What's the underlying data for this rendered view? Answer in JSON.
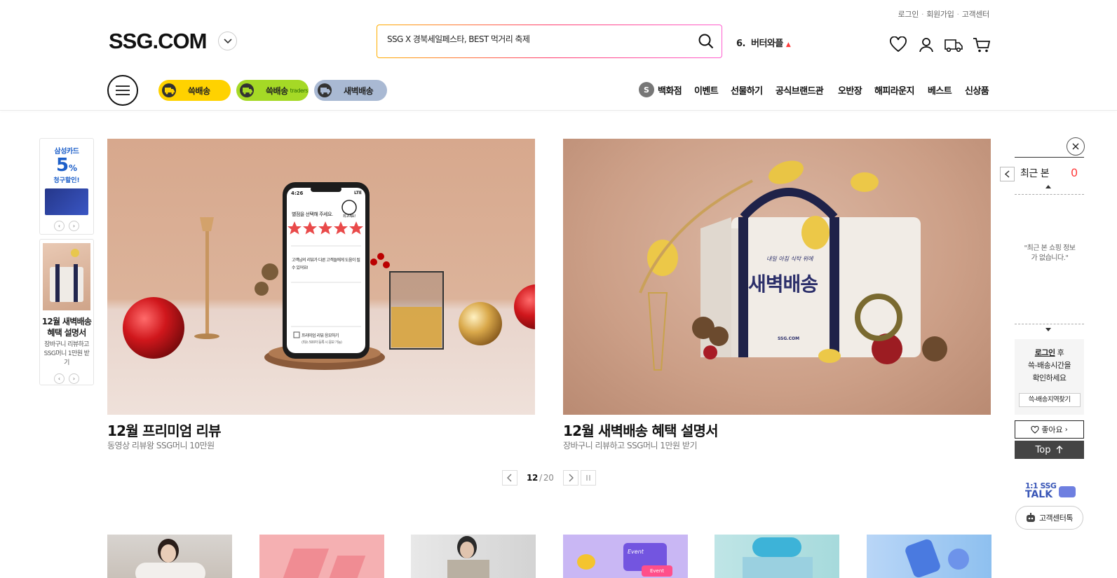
{
  "util": {
    "login": "로그인",
    "join": "회원가입",
    "cs": "고객센터"
  },
  "logo": "SSG.COM",
  "search": {
    "value": "SSG X 경북세일페스타, BEST 먹거리 축제"
  },
  "trend": {
    "rank": "6.",
    "keyword": "버터와플",
    "arrow": "▲"
  },
  "pills": [
    {
      "label": "쓱배송",
      "sub": "",
      "color": "#ffd200"
    },
    {
      "label": "쓱배송",
      "sub": "traders",
      "color": "#a5d926"
    },
    {
      "label": "새벽배송",
      "sub": "",
      "color": "#a9b9d3"
    }
  ],
  "gnb": {
    "s_badge": "S",
    "items": [
      "백화점",
      "이벤트",
      "선물하기",
      "공식브랜드관",
      "오반장",
      "해피라운지",
      "베스트",
      "신상품"
    ]
  },
  "side_ads": {
    "card": {
      "brand": "삼성카드",
      "pct": "5",
      "pct_unit": "%",
      "desc": "청구할인!"
    },
    "promo": {
      "title": "12월 새벽배송 혜택 설명서",
      "desc": "장바구니 리뷰하고 SSG머니 1만원 받기"
    }
  },
  "banners": [
    {
      "title": "12월 프리미엄 리뷰",
      "subtitle": "동영상 리뷰왕 SSG머니 10만원",
      "phone": {
        "time": "4:26",
        "signal": "LTE",
        "prompt": "별점을 선택해 주세요.",
        "mood": "최고예요!",
        "review": "고객님의 리뷰가 다른 고객들에게 도움이 될 수 있어요!",
        "check": "프리미엄 리뷰 응모하기",
        "note": "(최소 500자 등록 시 응모 가능)"
      }
    },
    {
      "title": "12월 새벽배송 혜택 설명서",
      "subtitle": "장바구니 리뷰하고 SSG머니 1만원 받기",
      "bag_text": "새벽배송",
      "bag_small": "SSG.COM",
      "bag_script": "내일 아침 식탁 위에"
    }
  ],
  "pager": {
    "current": "12",
    "sep": "/",
    "total": "20"
  },
  "thumbs": [
    {
      "text": ""
    },
    {
      "text": ""
    },
    {
      "text": ""
    },
    {
      "text": "Event",
      "text2": "Event"
    },
    {
      "text": ""
    },
    {
      "text": ""
    }
  ],
  "recent": {
    "title": "최근 본",
    "count": "0",
    "empty": "\"최근 본 쇼핑 정보가 없습니다.\""
  },
  "delivery": {
    "login": "로그인",
    "after": "후",
    "line2": "쓱-배송시간을",
    "line3": "확인하세요",
    "btn": "쓱-배송지역찾기"
  },
  "like_btn": "좋아요",
  "top_btn": "Top",
  "talk": {
    "l1": "1:1 SSG",
    "l2": "TALK",
    "cs": "고객센터톡"
  }
}
